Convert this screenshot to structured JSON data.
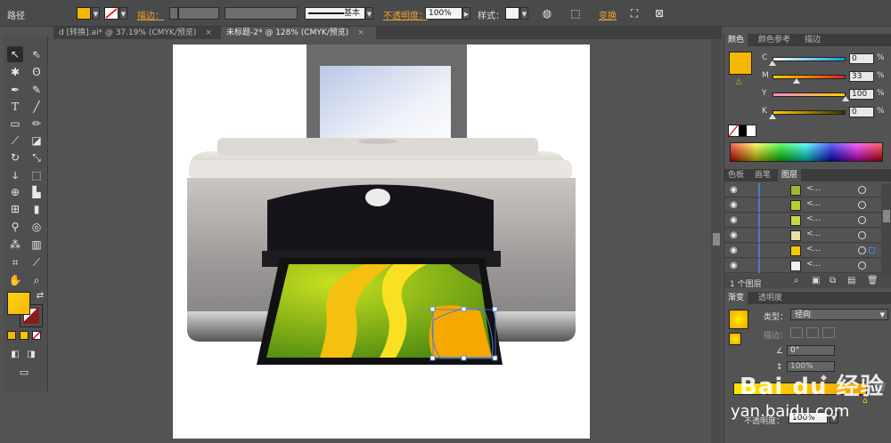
{
  "control_bar": {
    "selection_type": "路径",
    "stroke_label": "描边：",
    "stroke_profile": "基本",
    "opacity_label": "不透明度：",
    "opacity_value": "100%",
    "style_label": "样式：",
    "transform_label": "变换",
    "fill_color": "#f5b800"
  },
  "tabs": [
    {
      "label": "d [转换].ai* @ 37.19% (CMYK/预览)",
      "active": false,
      "close": "×"
    },
    {
      "label": "未标题-2* @ 128% (CMYK/预览)",
      "active": true,
      "close": "×"
    }
  ],
  "toolbox": {
    "fill_color": "#f5b800",
    "stroke_color": "#8a1c1c"
  },
  "color_panel": {
    "tabs": [
      "颜色",
      "颜色参考",
      "描边"
    ],
    "active_tab": "颜色",
    "swatch": "#f5b800",
    "channels": [
      {
        "label": "C",
        "value": "0",
        "fraction": 0.0
      },
      {
        "label": "M",
        "value": "33",
        "fraction": 0.33
      },
      {
        "label": "Y",
        "value": "100",
        "fraction": 1.0
      },
      {
        "label": "K",
        "value": "0",
        "fraction": 0.0
      }
    ]
  },
  "layers_panel": {
    "tabs": [
      "色板",
      "画笔",
      "图层"
    ],
    "active_tab": "图层",
    "rows": [
      {
        "name": "<...",
        "thumb": "#9ab830"
      },
      {
        "name": "<...",
        "thumb": "#b8d030"
      },
      {
        "name": "<...",
        "thumb": "#c8d840"
      },
      {
        "name": "<...",
        "thumb": "#e8e0a0"
      },
      {
        "name": "<...",
        "thumb": "#f5c800"
      },
      {
        "name": "<...",
        "thumb": "#f0f0e8"
      }
    ],
    "footer": "1 个图层"
  },
  "gradient_panel": {
    "tabs": [
      "渐变",
      "透明度"
    ],
    "active_tab": "渐变",
    "type_label": "类型：",
    "type_value": "径向",
    "stroke_label": "描边：",
    "angle_value": "0°",
    "aspect_value": "100%",
    "opacity_label": "不透明度：",
    "opacity_value": "100%"
  },
  "watermark": {
    "brand": "Bai du 经验",
    "url": "yan.baidu.com"
  }
}
